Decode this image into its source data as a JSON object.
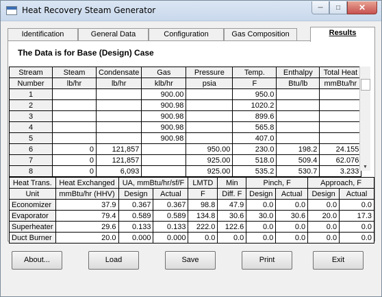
{
  "window": {
    "title": "Heat Recovery Steam Generator"
  },
  "tabs": [
    "Identification",
    "General Data",
    "Configuration",
    "Gas Composition",
    "Results"
  ],
  "case_label": "The Data is for Base (Design) Case",
  "stream_table": {
    "headers": [
      "Stream",
      "Steam",
      "Condensate",
      "Gas",
      "Pressure",
      "Temp.",
      "Enthalpy",
      "Total Heat"
    ],
    "units": [
      "Number",
      "lb/hr",
      "lb/hr",
      "klb/hr",
      "psia",
      "F",
      "Btu/lb",
      "mmBtu/hr"
    ],
    "rows": [
      [
        "1",
        "",
        "",
        "900.00",
        "",
        "950.0",
        "",
        ""
      ],
      [
        "2",
        "",
        "",
        "900.98",
        "",
        "1020.2",
        "",
        ""
      ],
      [
        "3",
        "",
        "",
        "900.98",
        "",
        "899.6",
        "",
        ""
      ],
      [
        "4",
        "",
        "",
        "900.98",
        "",
        "565.8",
        "",
        ""
      ],
      [
        "5",
        "",
        "",
        "900.98",
        "",
        "407.0",
        "",
        ""
      ],
      [
        "6",
        "0",
        "121,857",
        "",
        "950.00",
        "230.0",
        "198.2",
        "24.155"
      ],
      [
        "7",
        "0",
        "121,857",
        "",
        "925.00",
        "518.0",
        "509.4",
        "62.076"
      ],
      [
        "8",
        "0",
        "6,093",
        "",
        "925.00",
        "535.2",
        "530.7",
        "3.233"
      ]
    ]
  },
  "heat_table": {
    "header1": [
      "Heat Trans.",
      "Heat Exchanged",
      "UA, mmBtu/hr/sf/F",
      "LMTD",
      "Min",
      "Pinch, F",
      "Approach, F"
    ],
    "header2": [
      "Unit",
      "mmBtu/hr (HHV)",
      "Design",
      "Actual",
      "F",
      "Diff. F",
      "Design",
      "Actual",
      "Design",
      "Actual"
    ],
    "rows": [
      [
        "Economizer",
        "37.9",
        "0.367",
        "0.367",
        "98.8",
        "47.9",
        "0.0",
        "0.0",
        "0.0",
        "0.0"
      ],
      [
        "Evaporator",
        "79.4",
        "0.589",
        "0.589",
        "134.8",
        "30.6",
        "30.0",
        "30.6",
        "20.0",
        "17.3"
      ],
      [
        "Superheater",
        "29.6",
        "0.133",
        "0.133",
        "222.0",
        "122.6",
        "0.0",
        "0.0",
        "0.0",
        "0.0"
      ],
      [
        "Duct Burner",
        "20.0",
        "0.000",
        "0.000",
        "0.0",
        "0.0",
        "0.0",
        "0.0",
        "0.0",
        "0.0"
      ]
    ]
  },
  "buttons": {
    "about": "About...",
    "load": "Load",
    "save": "Save",
    "print": "Print",
    "exit": "Exit"
  },
  "icons": {
    "app": "app-window-icon",
    "minimize": "minimize-icon",
    "maximize": "maximize-icon",
    "close": "close-icon"
  }
}
